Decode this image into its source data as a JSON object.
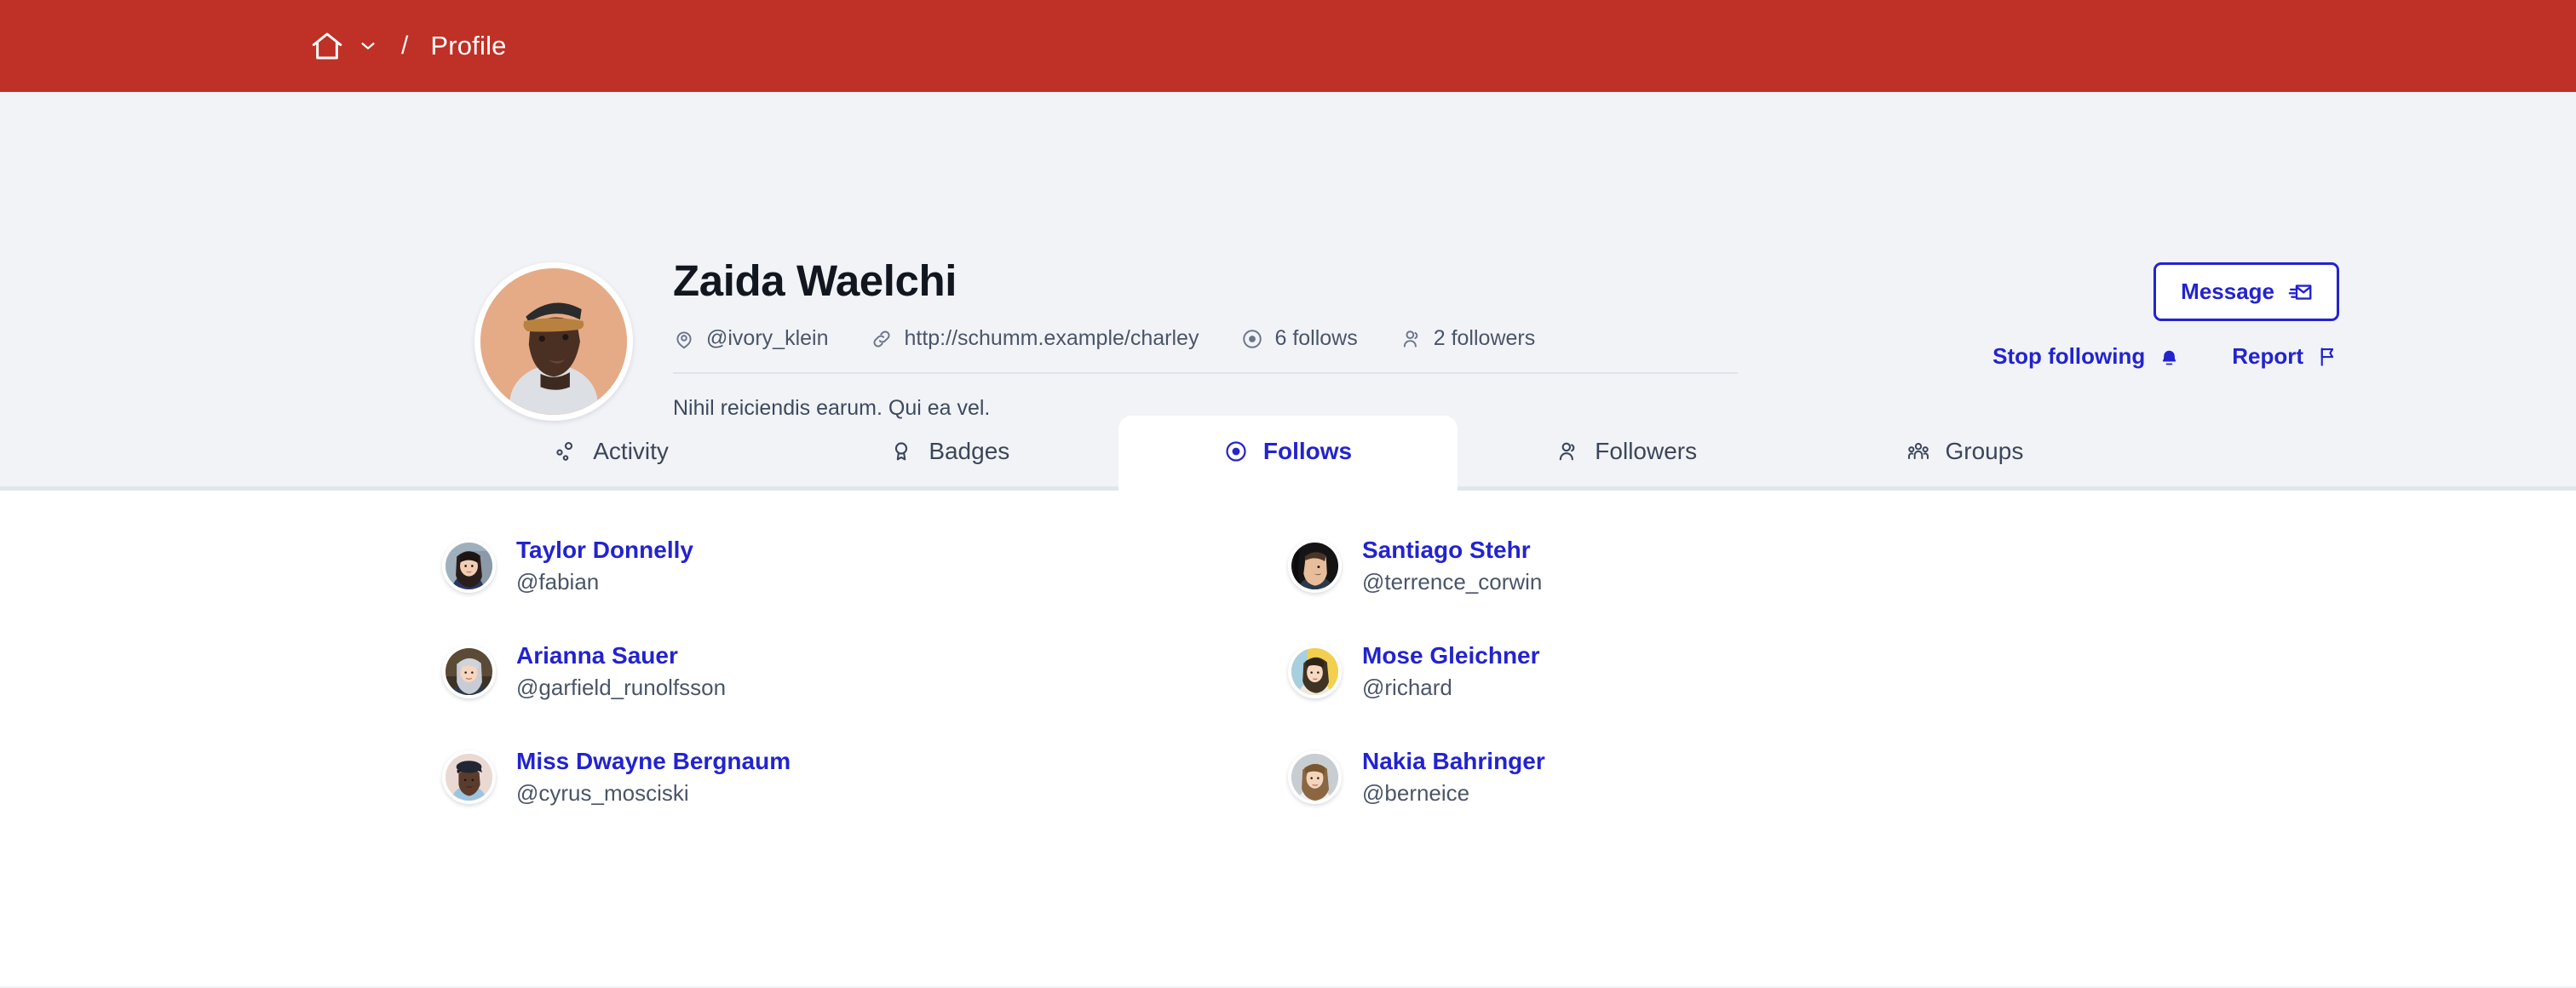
{
  "topbar": {
    "home_icon": "home-icon",
    "chevron_icon": "chevron-down-icon",
    "separator": "/",
    "current": "Profile",
    "bg_color": "#bf3026"
  },
  "profile": {
    "name": "Zaida Waelchi",
    "handle": "@ivory_klein",
    "website": "http://schumm.example/charley",
    "follows_count": "6 follows",
    "followers_count": "2 followers",
    "bio": "Nihil reiciendis earum. Qui ea vel.",
    "avatar_alt": "profile-photo"
  },
  "actions": {
    "message_label": "Message",
    "stop_following_label": "Stop following",
    "report_label": "Report",
    "accent_color": "#2323cf"
  },
  "tabs": [
    {
      "label": "Activity",
      "icon": "share-nodes-icon",
      "active": false
    },
    {
      "label": "Badges",
      "icon": "award-icon",
      "active": false
    },
    {
      "label": "Follows",
      "icon": "target-icon",
      "active": true
    },
    {
      "label": "Followers",
      "icon": "user-icon",
      "active": false
    },
    {
      "label": "Groups",
      "icon": "users-group-icon",
      "active": false
    }
  ],
  "follows": [
    {
      "name": "Taylor Donnelly",
      "handle": "@fabian"
    },
    {
      "name": "Santiago Stehr",
      "handle": "@terrence_corwin"
    },
    {
      "name": "Arianna Sauer",
      "handle": "@garfield_runolfsson"
    },
    {
      "name": "Mose Gleichner",
      "handle": "@richard"
    },
    {
      "name": "Miss Dwayne Bergnaum",
      "handle": "@cyrus_mosciski"
    },
    {
      "name": "Nakia Bahringer",
      "handle": "@berneice"
    }
  ]
}
